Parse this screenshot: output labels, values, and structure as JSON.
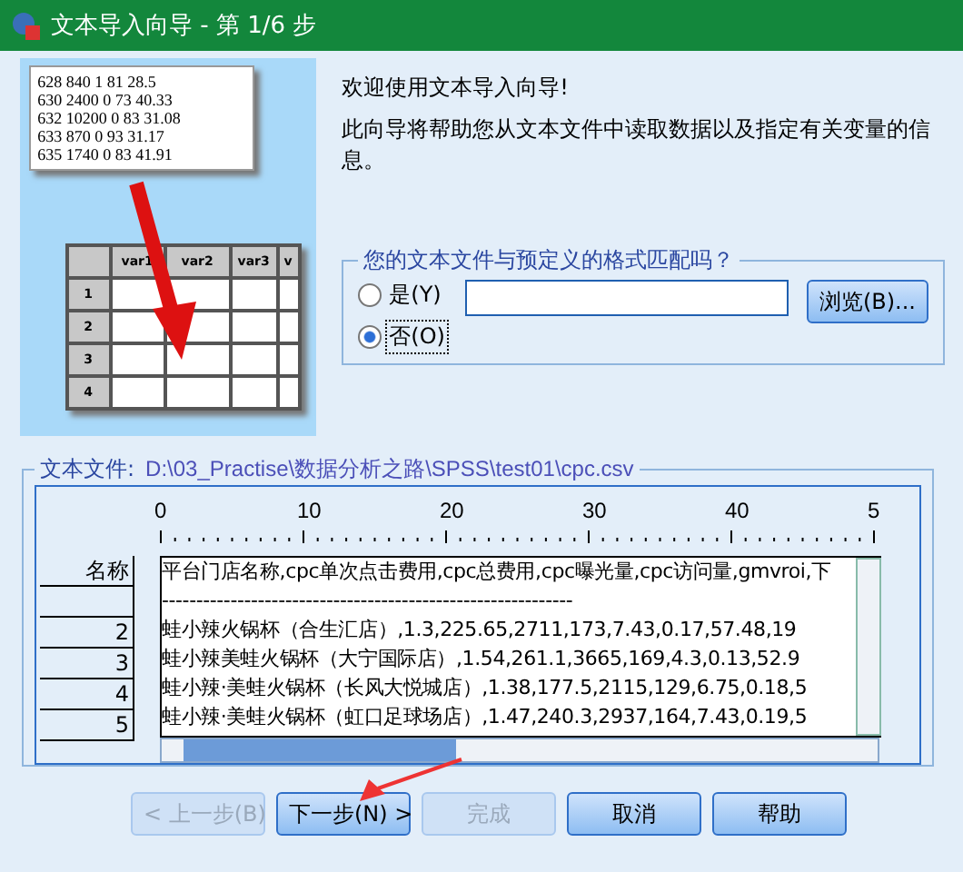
{
  "window": {
    "title": "文本导入向导 - 第 1/6 步"
  },
  "illustration": {
    "text_lines": [
      "628 840 1 81 28.5",
      "630 2400 0 73 40.33",
      "632 10200 0 83 31.08",
      "633 870 0 93 31.17",
      "635 1740 0 83 41.91"
    ],
    "columns": [
      "var1",
      "var2",
      "var3",
      "v"
    ],
    "rows": [
      "1",
      "2",
      "3",
      "4"
    ]
  },
  "welcome": "欢迎使用文本导入向导!",
  "description": "此向导将帮助您从文本文件中读取数据以及指定有关变量的信息。",
  "format_group": {
    "legend": "您的文本文件与预定义的格式匹配吗？",
    "options": [
      {
        "label": "是(Y)",
        "selected": false
      },
      {
        "label": "否(O)",
        "selected": true
      }
    ],
    "browse_button": "浏览(B)..."
  },
  "file_group": {
    "label": "文本文件:",
    "path": "D:\\03_Practise\\数据分析之路\\SPSS\\test01\\cpc.csv",
    "ruler": [
      "0",
      "10",
      "20",
      "30",
      "40",
      "5"
    ],
    "rows": [
      {
        "label": "名称",
        "text": "平台门店名称,cpc单次点击费用,cpc总费用,cpc曝光量,cpc访问量,gmvroi,下"
      },
      {
        "text": "------------------------------------------------------------"
      },
      {
        "label": "2",
        "text": "蛙小辣火锅杯（合生汇店）,1.3,225.65,2711,173,7.43,0.17,57.48,19"
      },
      {
        "label": "3",
        "text": "蛙小辣美蛙火锅杯（大宁国际店）,1.54,261.1,3665,169,4.3,0.13,52.9"
      },
      {
        "label": "4",
        "text": "蛙小辣·美蛙火锅杯（长风大悦城店）,1.38,177.5,2115,129,6.75,0.18,5"
      },
      {
        "label": "5",
        "text": "蛙小辣·美蛙火锅杯（虹口足球场店）,1.47,240.3,2937,164,7.43,0.19,5"
      }
    ]
  },
  "buttons": [
    {
      "label": "< 上一步(B)",
      "disabled": true
    },
    {
      "label": "下一步(N) >",
      "disabled": false
    },
    {
      "label": "完成",
      "disabled": true
    },
    {
      "label": "取消",
      "disabled": false
    },
    {
      "label": "帮助",
      "disabled": false
    }
  ]
}
